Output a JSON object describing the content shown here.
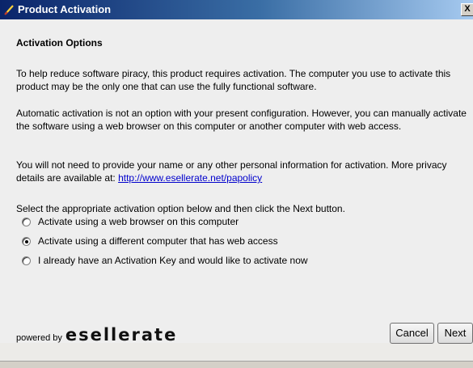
{
  "window": {
    "title": "Product Activation",
    "close_label": "X"
  },
  "section_heading": "Activation Options",
  "paragraphs": {
    "intro": "To help reduce software piracy, this product requires activation. The computer you use to activate this product may be the only one that can use the fully functional software.",
    "automatic": "Automatic activation is not an option with your present configuration. However, you can manually activate the software using a web browser on this computer or another computer with web access.",
    "privacy_prefix": "You will not need to provide your name or any other personal information for activation. More privacy details are available at: ",
    "privacy_link": "http://www.esellerate.net/papolicy",
    "instruction": "Select the appropriate activation option below and then click the Next button."
  },
  "options": [
    {
      "label": "Activate using a web browser on this computer",
      "selected": false
    },
    {
      "label": "Activate using a different computer that has web access",
      "selected": true
    },
    {
      "label": "I already have an Activation Key and would like to activate now",
      "selected": false
    }
  ],
  "branding": {
    "powered_by": "powered by",
    "logo_text": "esellerate"
  },
  "buttons": {
    "cancel": "Cancel",
    "next": "Next"
  }
}
